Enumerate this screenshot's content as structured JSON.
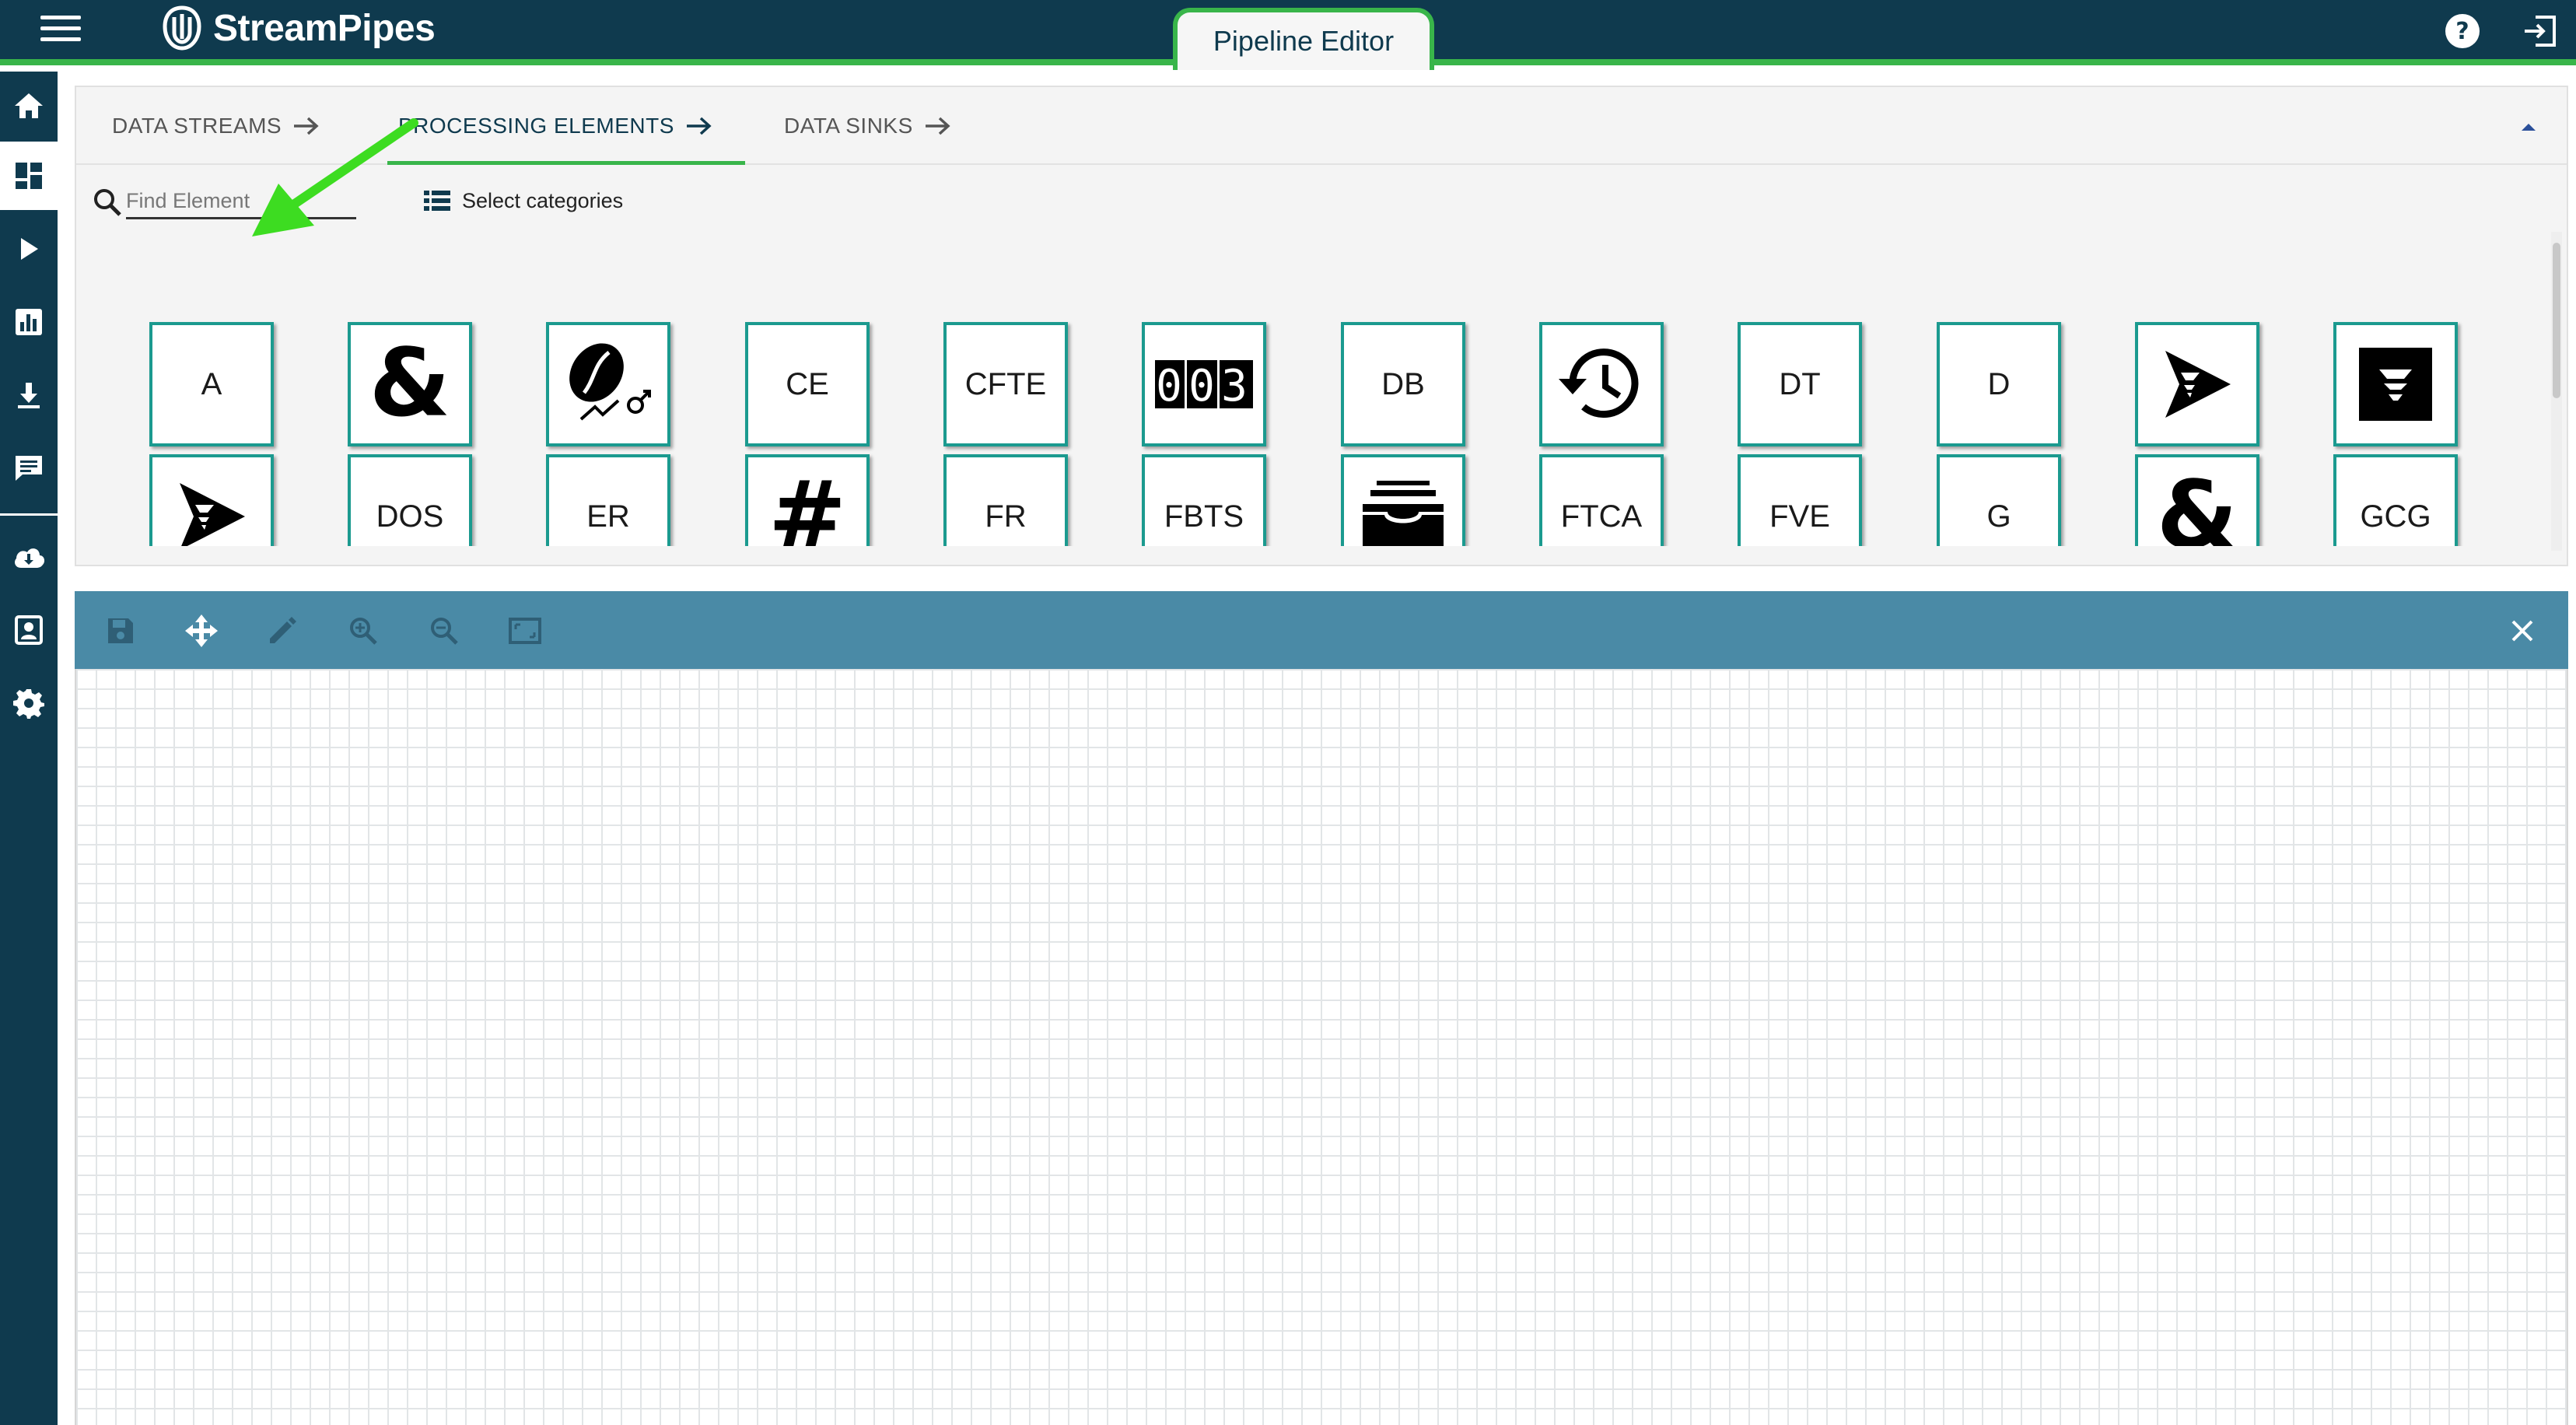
{
  "app": {
    "brand": "StreamPipes",
    "page_title": "Pipeline Editor"
  },
  "header_icons": [
    "help-icon",
    "logout-icon"
  ],
  "sidebar": {
    "items": [
      "home-icon",
      "dashboard-icon",
      "play-icon",
      "chart-icon",
      "download-icon",
      "message-icon",
      "cloud-download-icon",
      "contact-icon",
      "settings-icon"
    ],
    "active": "dashboard-icon"
  },
  "panel": {
    "tabs": [
      {
        "label": "DATA STREAMS"
      },
      {
        "label": "PROCESSING ELEMENTS"
      },
      {
        "label": "DATA SINKS"
      }
    ],
    "active_tab": "PROCESSING ELEMENTS",
    "search_placeholder": "Find Element",
    "categories_label": "Select categories"
  },
  "elements": {
    "row1": [
      {
        "label": "A",
        "type": "text"
      },
      {
        "label": "&",
        "type": "glyph"
      },
      {
        "label": "",
        "type": "icon",
        "icon": "coffee-bean-icon"
      },
      {
        "label": "CE",
        "type": "text"
      },
      {
        "label": "CFTE",
        "type": "text"
      },
      {
        "label": "",
        "type": "icon",
        "icon": "counter-icon"
      },
      {
        "label": "DB",
        "type": "text"
      },
      {
        "label": "",
        "type": "icon",
        "icon": "history-clock-icon"
      },
      {
        "label": "DT",
        "type": "text"
      },
      {
        "label": "D",
        "type": "text"
      },
      {
        "label": "",
        "type": "icon",
        "icon": "filter-arrow-icon"
      },
      {
        "label": "",
        "type": "icon",
        "icon": "filter-box-icon"
      }
    ],
    "row2": [
      {
        "label": "",
        "type": "icon",
        "icon": "filter-arrow-icon"
      },
      {
        "label": "DOS",
        "type": "text"
      },
      {
        "label": "ER",
        "type": "text"
      },
      {
        "label": "#",
        "type": "glyph"
      },
      {
        "label": "FR",
        "type": "text"
      },
      {
        "label": "FBTS",
        "type": "text"
      },
      {
        "label": "",
        "type": "icon",
        "icon": "archive-icon"
      },
      {
        "label": "FTCA",
        "type": "text"
      },
      {
        "label": "FVE",
        "type": "text"
      },
      {
        "label": "G",
        "type": "text"
      },
      {
        "label": "&",
        "type": "glyph"
      },
      {
        "label": "GCG",
        "type": "text"
      }
    ]
  },
  "canvas_toolbar": [
    "save-icon",
    "move-icon",
    "edit-icon",
    "zoom-in-icon",
    "zoom-out-icon",
    "fit-screen-icon"
  ],
  "colors": {
    "nav": "#0f3a4e",
    "accent": "#39b54a",
    "tile_border": "#1b9a8f",
    "toolbar": "#4a8aa6"
  }
}
